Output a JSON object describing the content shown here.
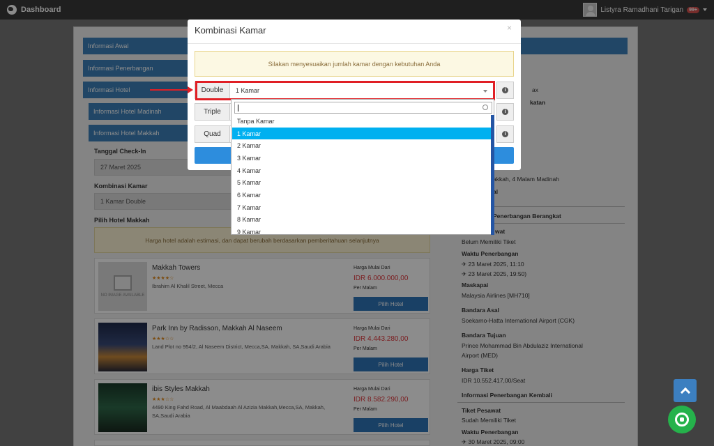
{
  "topbar": {
    "brand": "Dashboard",
    "user_name": "Listyra Ramadhani Tarigan",
    "notif": "99+"
  },
  "sections": {
    "awal": "Informasi Awal",
    "penerbangan": "Informasi Penerbangan",
    "hotel": "Informasi Hotel",
    "hotel_madinah": "Informasi Hotel Madinah",
    "hotel_makkah": "Informasi Hotel Makkah"
  },
  "form": {
    "checkin_label": "Tanggal Check-In",
    "checkin_value": "27 Maret 2025",
    "kombinasi_label": "Kombinasi Kamar",
    "kombinasi_value": "1 Kamar Double",
    "pilih_label": "Pilih Hotel Makkah",
    "notice": "Harga hotel adalah estimasi, dan dapat berubah berdasarkan pemberitahuan selanjutnya"
  },
  "hotels": [
    {
      "name": "Makkah Towers",
      "stars": "★★★★☆",
      "address": "Ibrahim Al Khalil Street, Mecca",
      "price_label": "Harga Mulai Dari",
      "price": "IDR 6.000.000,00",
      "per": "Per Malam",
      "button": "Pilih Hotel",
      "no_image": "NO IMAGE AVAILABLE"
    },
    {
      "name": "Park Inn by Radisson, Makkah Al Naseem",
      "stars": "★★★☆☆",
      "address": "Land Plot no 954/2, Al Naseem District, Mecca,SA, Makkah, SA,Saudi Arabia",
      "price_label": "Harga Mulai Dari",
      "price": "IDR 4.443.280,00",
      "per": "Per Malam",
      "button": "Pilih Hotel"
    },
    {
      "name": "ibis Styles Makkah",
      "stars": "★★★☆☆",
      "address": "4490 King Fahd Road, Al Maabdaah Al Azizia Makkah,Mecca,SA, Makkah, SA,Saudi Arabia",
      "price_label": "Harga Mulai Dari",
      "price": "IDR 8.582.290,00",
      "per": "Per Malam",
      "button": "Pilih Hotel"
    }
  ],
  "side": {
    "pax": "ax",
    "katan": "katan",
    "nights": "akkah, 4 Malam Madinah",
    "al": "al",
    "berangkat_title": "Penerbangan Berangkat",
    "s_wat": "wat",
    "tiket_status": "Belum Memiliki Tiket",
    "waktu_label": "Waktu Penerbangan",
    "waktu_1": "✈ 23 Maret 2025, 11:10",
    "waktu_2": "✈ 23 Maret 2025, 19:50)",
    "maskapai_label": "Maskapai",
    "maskapai_value": "Malaysia Airlines [MH710]",
    "asal_label": "Bandara Asal",
    "asal_value": "Soekarno-Hatta International Airport (CGK)",
    "tujuan_label": "Bandara Tujuan",
    "tujuan_value_1": "Prince Mohammad Bin Abdulaziz International",
    "tujuan_value_2": "Airport (MED)",
    "harga_label": "Harga Tiket",
    "harga_value": "IDR 10.552.417,00/Seat",
    "kembali_title": "Informasi Penerbangan Kembali",
    "tiket_label": "Tiket Pesawat",
    "tiket_value": "Sudah Memiliki Tiket",
    "waktu_k_label": "Waktu Penerbangan",
    "waktu_k_1": "✈ 30 Maret 2025, 09:00"
  },
  "modal": {
    "title": "Kombinasi Kamar",
    "close": "×",
    "alert": "Silakan menyesuaikan jumlah kamar dengan kebutuhan Anda",
    "rows": [
      {
        "label": "Double",
        "value": "1 Kamar"
      },
      {
        "label": "Triple",
        "value": ""
      },
      {
        "label": "Quad",
        "value": ""
      }
    ],
    "info_glyph": "i"
  },
  "dropdown": {
    "options": [
      "Tanpa Kamar",
      "1 Kamar",
      "2 Kamar",
      "3 Kamar",
      "4 Kamar",
      "5 Kamar",
      "6 Kamar",
      "7 Kamar",
      "8 Kamar",
      "9 Kamar"
    ],
    "selected": "1 Kamar"
  }
}
